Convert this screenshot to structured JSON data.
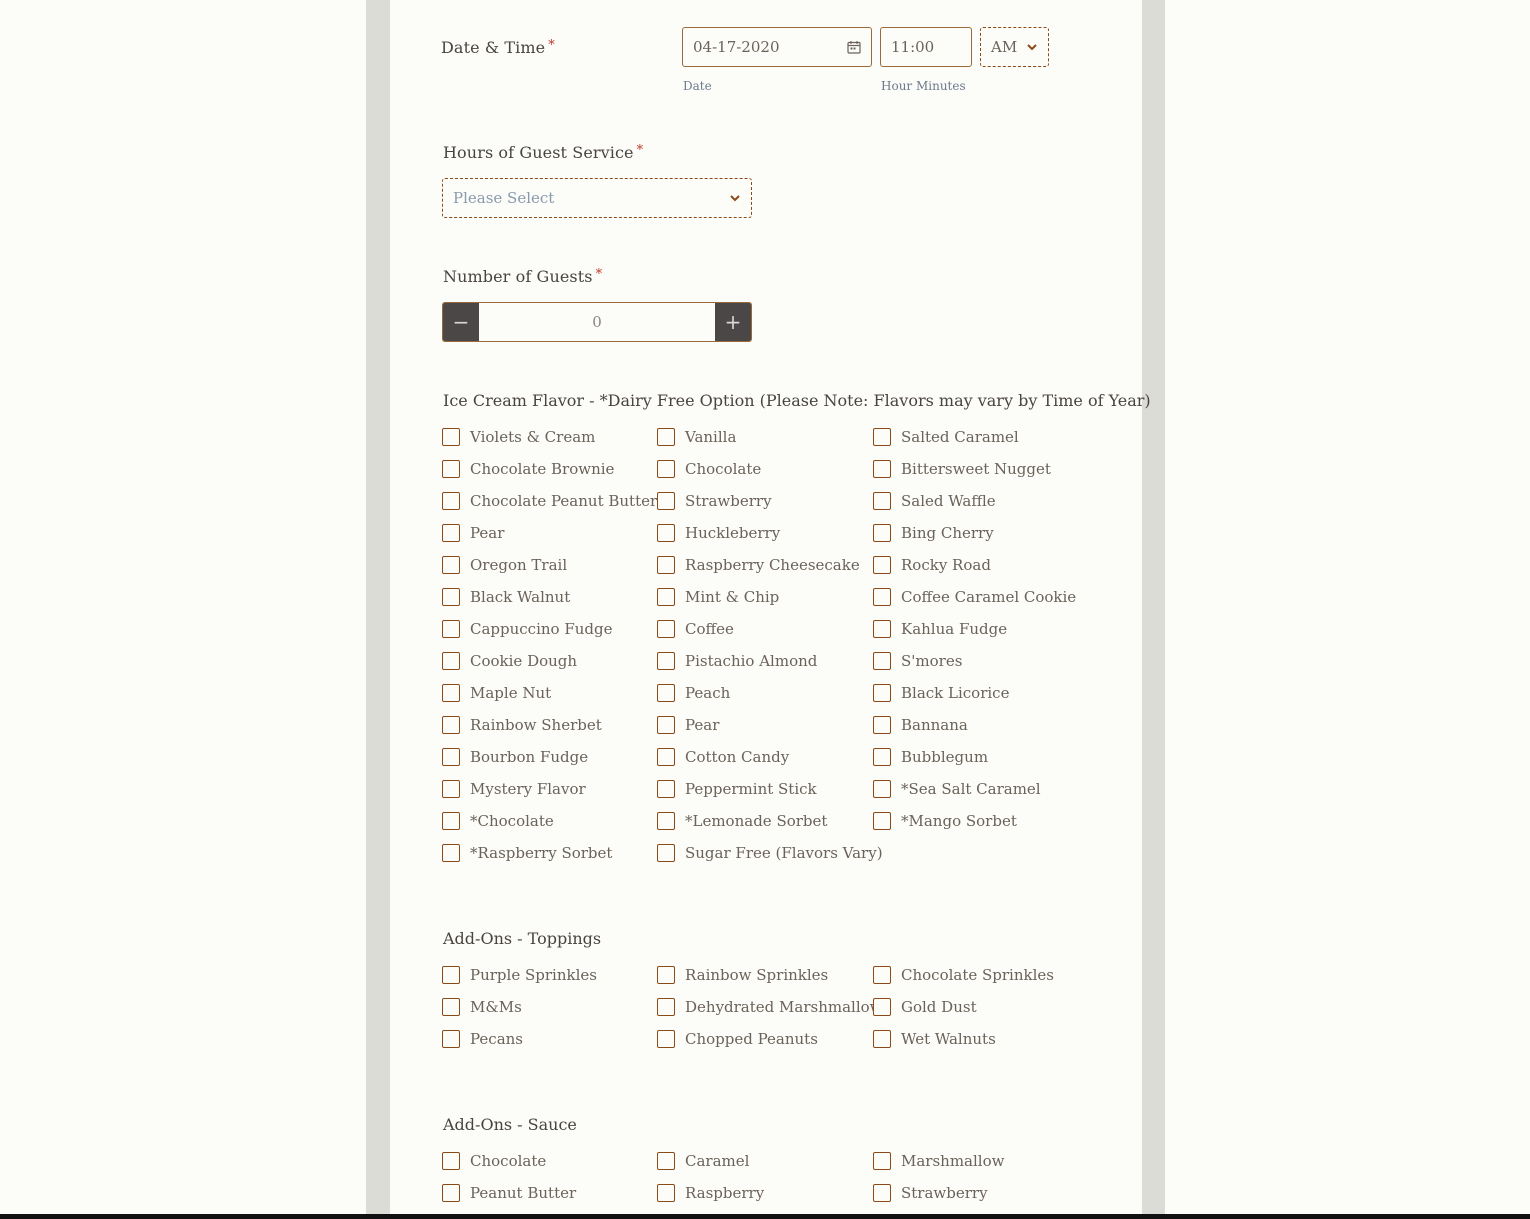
{
  "datetime": {
    "label": "Date & Time",
    "required_mark": "*",
    "date_value": "04-17-2020",
    "date_sublabel": "Date",
    "time_value": "11:00",
    "time_sublabel": "Hour Minutes",
    "ampm_value": "AM"
  },
  "hours_service": {
    "label": "Hours of Guest Service",
    "required_mark": "*",
    "placeholder": "Please Select"
  },
  "guests": {
    "label": "Number of Guests",
    "required_mark": "*",
    "value": "0",
    "minus": "−",
    "plus": "+"
  },
  "flavors": {
    "title": "Ice Cream Flavor - *Dairy Free Option (Please Note: Flavors may vary by Time of Year)",
    "columns": [
      [
        "Violets & Cream",
        "Chocolate Brownie",
        "Chocolate Peanut Butter",
        "Pear",
        "Oregon Trail",
        "Black Walnut",
        "Cappuccino Fudge",
        "Cookie Dough",
        "Maple Nut",
        "Rainbow Sherbet",
        "Bourbon Fudge",
        "Mystery Flavor",
        "*Chocolate",
        "*Raspberry Sorbet"
      ],
      [
        "Vanilla",
        "Chocolate",
        "Strawberry",
        "Huckleberry",
        "Raspberry Cheesecake",
        "Mint & Chip",
        "Coffee",
        "Pistachio Almond",
        "Peach",
        "Pear",
        "Cotton Candy",
        "Peppermint Stick",
        "*Lemonade Sorbet",
        "Sugar Free (Flavors Vary)"
      ],
      [
        "Salted Caramel",
        "Bittersweet Nugget",
        "Saled Waffle",
        "Bing Cherry",
        "Rocky Road",
        "Coffee Caramel Cookie",
        "Kahlua Fudge",
        "S'mores",
        "Black Licorice",
        "Bannana",
        "Bubblegum",
        "*Sea Salt Caramel",
        "*Mango Sorbet"
      ]
    ]
  },
  "toppings": {
    "title": "Add-Ons - Toppings",
    "columns": [
      [
        "Purple Sprinkles",
        "M&Ms",
        "Pecans"
      ],
      [
        "Rainbow Sprinkles",
        "Dehydrated Marshmallows",
        "Chopped Peanuts"
      ],
      [
        "Chocolate Sprinkles",
        "Gold Dust",
        "Wet Walnuts"
      ]
    ]
  },
  "sauce": {
    "title": "Add-Ons - Sauce",
    "columns": [
      [
        "Chocolate",
        "Peanut Butter"
      ],
      [
        "Caramel",
        "Raspberry"
      ],
      [
        "Marshmallow",
        "Strawberry"
      ]
    ]
  }
}
